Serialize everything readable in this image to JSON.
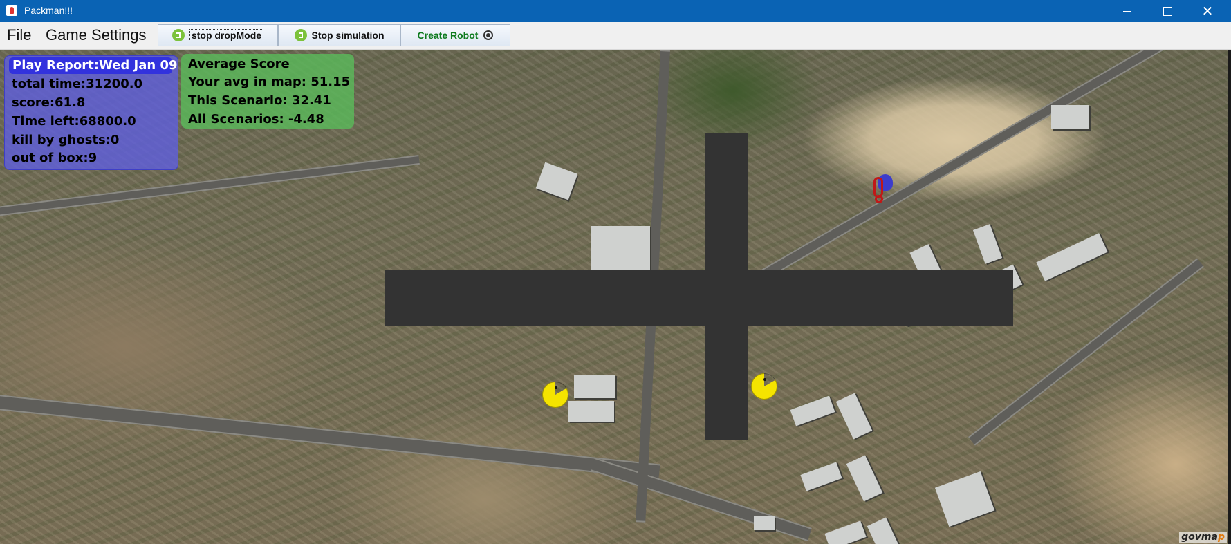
{
  "window": {
    "title": "Packman!!!",
    "controls": {
      "minimize": "",
      "maximize": "",
      "close": "✕"
    }
  },
  "menubar": {
    "file": "File",
    "game_settings": "Game Settings",
    "buttons": {
      "drop_mode": "stop dropMode",
      "simulation": "Stop simulation",
      "create_robot": "Create Robot"
    }
  },
  "play_report": {
    "title": "Play Report:Wed Jan 09",
    "total_time": "total time:31200.0",
    "score": "score:61.8",
    "time_left": " Time left:68800.0",
    "killed_by_ghosts": " kill by ghosts:0",
    "out_of_box": " out of box:9"
  },
  "average_score": {
    "title": "Average Score",
    "avg_in_map": "Your avg in map: 51.15",
    "this_scenario": "This Scenario: 32.41",
    "all_scenarios": "All Scenarios: -4.48"
  },
  "map": {
    "watermark_prefix": "govma",
    "watermark_o": "p",
    "watermark_suffix": ""
  },
  "colors": {
    "wall": "#333333",
    "pacman": "#f5e400",
    "report_panel": "#5f5fdc",
    "score_panel": "#5ab95a",
    "titlebar": "#0a63b4"
  },
  "icons": {
    "drop_mode": "green-exit-icon",
    "simulation": "green-exit-icon",
    "create_robot": "robot-icon"
  }
}
